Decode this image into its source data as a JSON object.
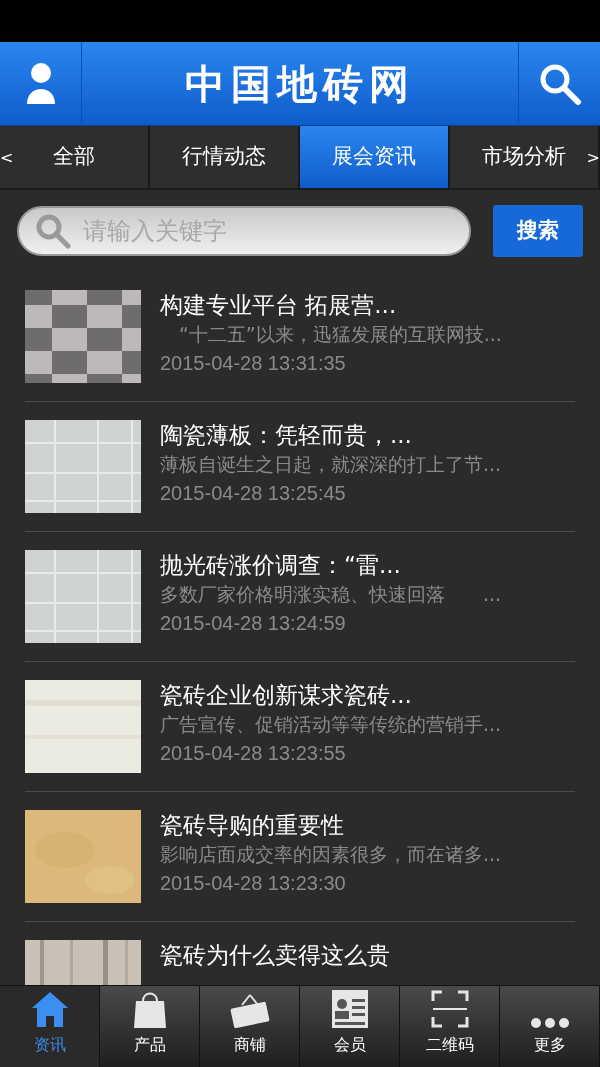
{
  "header": {
    "title": "中国地砖网"
  },
  "tabs": {
    "prev_arrow": "<",
    "next_arrow": ">",
    "items": [
      {
        "label": "全部",
        "selected": false
      },
      {
        "label": "行情动态",
        "selected": false
      },
      {
        "label": "展会资讯",
        "selected": true
      },
      {
        "label": "市场分析",
        "selected": false
      }
    ]
  },
  "search": {
    "placeholder": "请输入关键字",
    "button": "搜索"
  },
  "articles": [
    {
      "title": "构建专业平台 拓展营...",
      "summary": "　“十二五”以来，迅猛发展的互联网技...",
      "time": "2015-04-28 13:31:35"
    },
    {
      "title": "陶瓷薄板：凭轻而贵，...",
      "summary": "薄板自诞生之日起，就深深的打上了节...",
      "time": "2015-04-28 13:25:45"
    },
    {
      "title": "抛光砖涨价调查：“雷...",
      "summary": "多数厂家价格明涨实稳、快速回落　　...",
      "time": "2015-04-28 13:24:59"
    },
    {
      "title": "瓷砖企业创新谋求瓷砖...",
      "summary": "广告宣传、促销活动等等传统的营销手...",
      "time": "2015-04-28 13:23:55"
    },
    {
      "title": "瓷砖导购的重要性",
      "summary": "影响店面成交率的因素很多，而在诸多...",
      "time": "2015-04-28 13:23:30"
    },
    {
      "title": "瓷砖为什么卖得这么贵"
    }
  ],
  "bottom_nav": [
    {
      "label": "资讯",
      "kind": "home",
      "selected": true
    },
    {
      "label": "产品",
      "kind": "bag",
      "selected": false
    },
    {
      "label": "商铺",
      "kind": "sign",
      "selected": false
    },
    {
      "label": "会员",
      "kind": "card",
      "selected": false
    },
    {
      "label": "二维码",
      "kind": "scan",
      "selected": false
    },
    {
      "label": "更多",
      "kind": "more",
      "selected": false
    }
  ]
}
